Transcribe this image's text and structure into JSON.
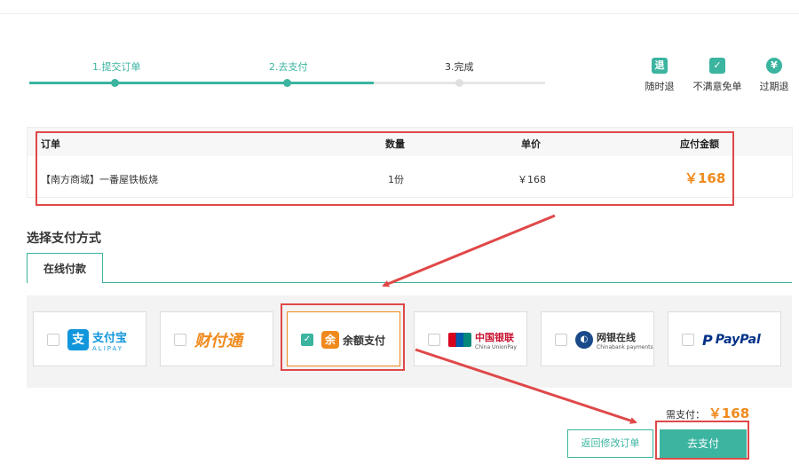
{
  "steps": [
    {
      "label": "1.提交订单",
      "status": "done"
    },
    {
      "label": "2.去支付",
      "status": "done"
    },
    {
      "label": "3.完成",
      "status": "todo"
    }
  ],
  "guarantees": [
    {
      "icon": "refund-anytime-icon",
      "glyph": "退",
      "label": "随时退"
    },
    {
      "icon": "check-icon",
      "glyph": "✓",
      "label": "不满意免单"
    },
    {
      "icon": "expired-refund-icon",
      "glyph": "¥",
      "label": "过期退"
    }
  ],
  "order": {
    "headers": {
      "item": "订单",
      "qty": "数量",
      "unit_price": "单价",
      "total": "应付金额"
    },
    "row": {
      "item": "【南方商城】一番屋铁板烧",
      "qty": "1份",
      "unit_price": "￥168",
      "total": "￥168"
    }
  },
  "payment": {
    "title": "选择支付方式",
    "tab": "在线付款",
    "methods": [
      {
        "name": "支付宝",
        "sub": "ALIPAY",
        "checked": false,
        "icon": "alipay-logo-icon"
      },
      {
        "name": "财付通",
        "sub": "",
        "checked": false,
        "icon": "tenpay-logo-icon"
      },
      {
        "name": "余额支付",
        "sub": "",
        "checked": true,
        "icon": "balance-pay-icon"
      },
      {
        "name": "中国银联",
        "sub": "China UnionPay",
        "checked": false,
        "icon": "unionpay-logo-icon"
      },
      {
        "name": "网银在线",
        "sub": "Chinabank payments",
        "checked": false,
        "icon": "chinabank-logo-icon"
      },
      {
        "name": "PayPal",
        "sub": "",
        "checked": false,
        "icon": "paypal-logo-icon"
      }
    ]
  },
  "footer": {
    "need_pay_label": "需支付：",
    "need_pay_amount": "￥168",
    "back_button": "返回修改订单",
    "pay_button": "去支付"
  },
  "colors": {
    "accent": "#3bb4a0",
    "price": "#f08a1c",
    "highlight": "#e04848"
  }
}
